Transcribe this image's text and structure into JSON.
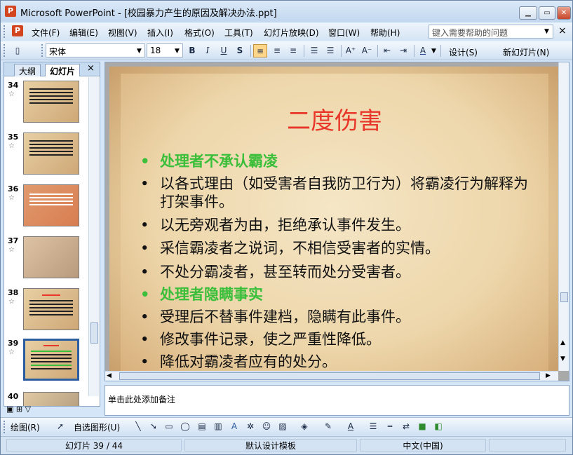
{
  "window": {
    "title": "Microsoft PowerPoint - [校园暴力产生的原因及解决办法.ppt]",
    "minimize": "▁",
    "restore": "▭",
    "close": "✕"
  },
  "menu": {
    "items": [
      "文件(F)",
      "编辑(E)",
      "视图(V)",
      "插入(I)",
      "格式(O)",
      "工具(T)",
      "幻灯片放映(D)",
      "窗口(W)",
      "帮助(H)"
    ],
    "help_placeholder": "键入需要帮助的问题",
    "close": "×"
  },
  "toolbar": {
    "font_name": "宋体",
    "font_size": "18",
    "bold": "B",
    "italic": "I",
    "underline": "U",
    "shadow": "S",
    "design_label": "设计(S)",
    "new_slide_label": "新幻灯片(N)"
  },
  "left_pane": {
    "tabs": [
      "大纲",
      "幻灯片"
    ],
    "close": "×",
    "thumbnails": [
      {
        "num": "34"
      },
      {
        "num": "35"
      },
      {
        "num": "36"
      },
      {
        "num": "37"
      },
      {
        "num": "38"
      },
      {
        "num": "39"
      },
      {
        "num": "40"
      }
    ]
  },
  "slide": {
    "title": "二度伤害",
    "bullets": [
      {
        "text": "处理者不承认霸凌",
        "style": "green"
      },
      {
        "text": "以各式理由（如受害者自我防卫行为）将霸凌行为解释为打架事件。",
        "style": "normal"
      },
      {
        "text": "以无旁观者为由，拒绝承认事件发生。",
        "style": "normal"
      },
      {
        "text": "采信霸凌者之说词，不相信受害者的实情。",
        "style": "normal"
      },
      {
        "text": "不处分霸凌者，甚至转而处分受害者。",
        "style": "normal"
      },
      {
        "text": "处理者隐瞒事实",
        "style": "green"
      },
      {
        "text": "受理后不替事件建档，隐瞒有此事件。",
        "style": "normal"
      },
      {
        "text": "修改事件记录，使之严重性降低。",
        "style": "normal"
      },
      {
        "text": "降低对霸凌者应有的处分。",
        "style": "normal"
      }
    ]
  },
  "notes": {
    "placeholder": "单击此处添加备注"
  },
  "drawbar": {
    "draw_label": "绘图(R)",
    "autoshape_label": "自选图形(U)"
  },
  "status": {
    "slide_info": "幻灯片 39 / 44",
    "template": "默认设计模板",
    "language": "中文(中国)"
  }
}
